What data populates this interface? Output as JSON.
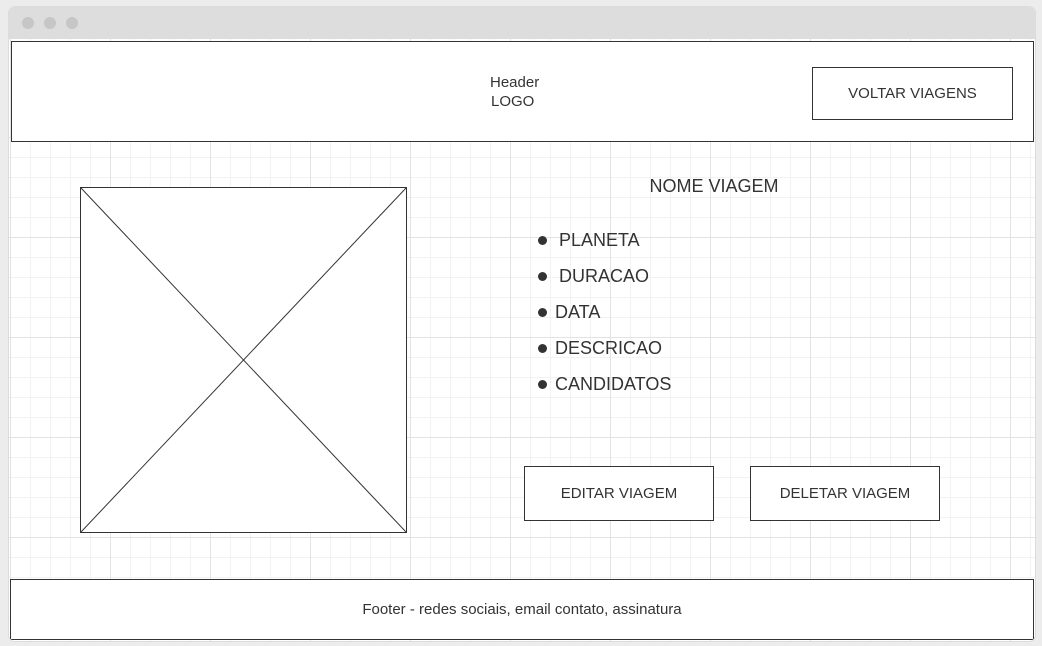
{
  "header": {
    "line1": "Header",
    "line2": "LOGO",
    "back_button": "VOLTAR VIAGENS"
  },
  "trip": {
    "title": "NOME VIAGEM",
    "fields": [
      "PLANETA",
      "DURACAO",
      "DATA",
      "DESCRICAO",
      "CANDIDATOS"
    ],
    "image_icon": "image-placeholder-icon"
  },
  "actions": {
    "edit": "EDITAR VIAGEM",
    "delete": "DELETAR VIAGEM"
  },
  "footer": {
    "text": "Footer - redes sociais, email contato, assinatura"
  },
  "colors": {
    "stroke": "#333333",
    "grid": "#e3e3e3",
    "chrome": "#dddddd"
  }
}
